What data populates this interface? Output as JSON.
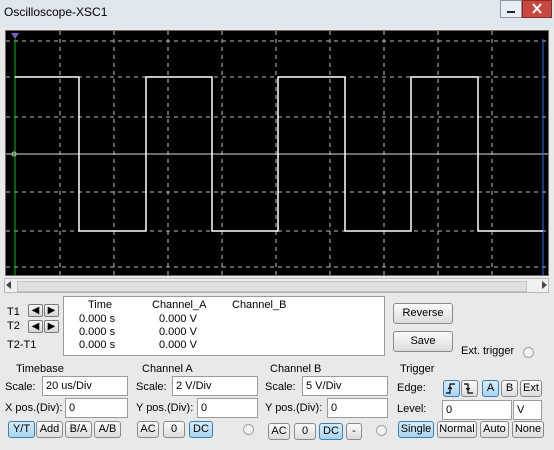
{
  "window": {
    "title": "Oscilloscope-XSC1"
  },
  "colors": {
    "screen_bg": "#000000",
    "trace": "#ffffff",
    "grid": "#bfbfbf",
    "selected": "#a9d3f3"
  },
  "cursors": {
    "t1_label": "T1",
    "t2_label": "T2",
    "t2t1_label": "T2-T1",
    "headers": {
      "time": "Time",
      "channel_a": "Channel_A",
      "channel_b": "Channel_B"
    },
    "rows": [
      {
        "time": "0.000 s",
        "channel_a": "0.000 V",
        "channel_b": ""
      },
      {
        "time": "0.000 s",
        "channel_a": "0.000 V",
        "channel_b": ""
      },
      {
        "time": "0.000 s",
        "channel_a": "0.000 V",
        "channel_b": ""
      }
    ]
  },
  "buttons": {
    "reverse": "Reverse",
    "save": "Save",
    "ext_trigger": "Ext. trigger"
  },
  "timebase": {
    "title": "Timebase",
    "scale_label": "Scale:",
    "scale_value": "20 us/Div",
    "xpos_label": "X pos.(Div):",
    "xpos_value": "0",
    "modes": [
      "Y/T",
      "Add",
      "B/A",
      "A/B"
    ],
    "selected_mode": "Y/T"
  },
  "channel_a": {
    "title": "Channel A",
    "scale_label": "Scale:",
    "scale_value": "2  V/Div",
    "ypos_label": "Y pos.(Div):",
    "ypos_value": "0",
    "coupling": [
      "AC",
      "0",
      "DC"
    ],
    "selected_coupling": "DC"
  },
  "channel_b": {
    "title": "Channel B",
    "scale_label": "Scale:",
    "scale_value": "5  V/Div",
    "ypos_label": "Y pos.(Div):",
    "ypos_value": "0",
    "coupling": [
      "AC",
      "0",
      "DC",
      "-"
    ],
    "selected_coupling": "DC"
  },
  "trigger": {
    "title": "Trigger",
    "edge_label": "Edge:",
    "level_label": "Level:",
    "level_value": "0",
    "level_unit": "V",
    "sources": [
      "A",
      "B",
      "Ext"
    ],
    "selected_source": "A",
    "modes": [
      "Single",
      "Normal",
      "Auto",
      "None"
    ],
    "selected_mode": "Single"
  }
}
